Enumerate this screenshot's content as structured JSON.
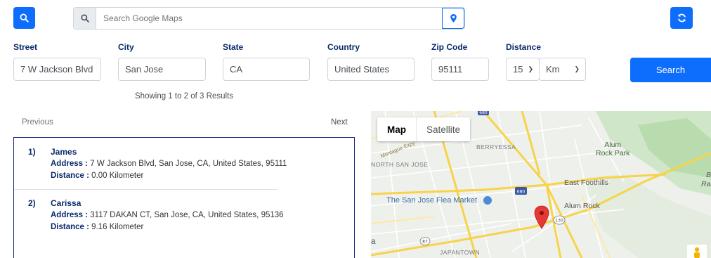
{
  "topbar": {
    "search_placeholder": "Search Google Maps"
  },
  "form": {
    "labels": {
      "street": "Street",
      "city": "City",
      "state": "State",
      "country": "Country",
      "zip": "Zip Code",
      "distance": "Distance"
    },
    "values": {
      "street": "7 W Jackson Blvd",
      "city": "San Jose",
      "state": "CA",
      "country": "United States",
      "zip": "95111",
      "distance": "15",
      "unit": "Km"
    },
    "search_label": "Search"
  },
  "results": {
    "summary": "Showing 1 to 2 of 3 Results",
    "previous": "Previous",
    "next": "Next",
    "address_label": "Address :",
    "distance_label": "Distance :",
    "items": [
      {
        "index": "1)",
        "name": "James",
        "address": "7 W Jackson Blvd, San Jose, CA, United States, 95111",
        "distance": "0.00 Kilometer"
      },
      {
        "index": "2)",
        "name": "Carissa",
        "address": "3117 DAKAN CT, San Jose, CA, United States, 95136",
        "distance": "9.16 Kilometer"
      }
    ]
  },
  "map": {
    "tab_map": "Map",
    "tab_satellite": "Satellite",
    "labels": {
      "berryessa": "BERRYESSA",
      "north_san_jose": "NORTH SAN JOSE",
      "montague": "Montague Expy",
      "alum_rock_park": "Alum Rock Park",
      "alum_rock_park_line1": "Alum",
      "alum_rock_park_line2": "Rock Park",
      "east_foothills": "East Foothills",
      "alum_rock": "Alum Rock",
      "flea_market": "The San Jose Flea Market",
      "japantown": "JAPANTOWN",
      "edge_b": "B",
      "edge_ran": "Ran",
      "edge_a": "a",
      "shield_680": "680",
      "shield_130": "130",
      "shield_87": "87"
    }
  },
  "colors": {
    "primary": "#0d6efd",
    "label_navy": "#0a2a6b",
    "pin_red": "#e53935"
  }
}
